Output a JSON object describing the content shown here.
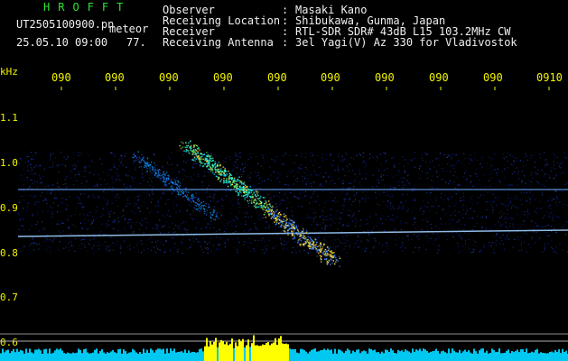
{
  "header": {
    "app_name": "HROFFT",
    "file_name": "UT2505100900.pn",
    "meteor_label": "meteor",
    "date_time": "25.05.10 09:00",
    "frame_count": "77.",
    "info": [
      {
        "key": "Observer",
        "sep": ":",
        "value": "Masaki Kano"
      },
      {
        "key": "Receiving Location",
        "sep": ":",
        "value": "Shibukawa, Gunma, Japan"
      },
      {
        "key": "Receiver",
        "sep": ":",
        "value": "RTL-SDR SDR# 43dB L15 103.2MHz CW"
      },
      {
        "key": "Receiving Antenna",
        "sep": ":",
        "value": "3el Yagi(V) Az 330 for Vladivostok"
      }
    ]
  },
  "axes": {
    "freq_unit": "kHz",
    "time_ticks": [
      "090",
      "090",
      "090",
      "090",
      "090",
      "090",
      "090",
      "090",
      "090",
      "0910"
    ],
    "freq_ticks": [
      "1.1",
      "1.0",
      "0.9",
      "0.8",
      "0.7",
      "0.6"
    ]
  },
  "colors": {
    "header_green": "#30e030",
    "header_white": "#f0f0f0",
    "axis_yellow": "#f4f400",
    "signal_cyan": "#00e0ff",
    "signal_blue": "#1f3fd0",
    "power_yellow": "#ffff00"
  }
}
